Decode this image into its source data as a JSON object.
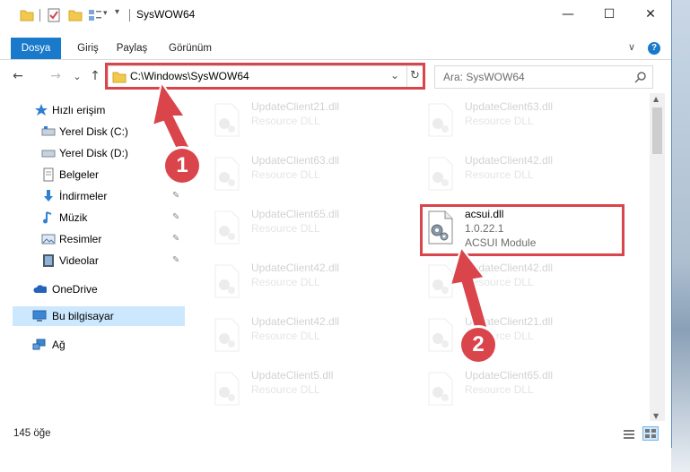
{
  "window": {
    "title": "SysWOW64",
    "minimize_glyph": "—",
    "maximize_glyph": "☐",
    "close_glyph": "✕"
  },
  "ribbon": {
    "tabs": [
      "Dosya",
      "Giriş",
      "Paylaş",
      "Görünüm"
    ],
    "help_glyph": "?",
    "collapse_glyph": "∨"
  },
  "nav": {
    "back_glyph": "←",
    "forward_glyph": "→",
    "recent_glyph": "⌄",
    "up_glyph": "↑",
    "address": "C:\\Windows\\SysWOW64",
    "refresh_glyph": "↻",
    "dropdown_glyph": "⌄",
    "search_placeholder": "Ara: SysWOW64",
    "search_icon": "search-icon"
  },
  "sidebar": {
    "items": [
      {
        "label": "Hızlı erişim",
        "icon": "star-icon"
      },
      {
        "label": "Yerel Disk (C:)",
        "icon": "drive-icon"
      },
      {
        "label": "Yerel Disk (D:)",
        "icon": "drive-icon"
      },
      {
        "label": "Belgeler",
        "icon": "documents-icon"
      },
      {
        "label": "İndirmeler",
        "icon": "download-icon"
      },
      {
        "label": "Müzik",
        "icon": "music-icon"
      },
      {
        "label": "Resimler",
        "icon": "pictures-icon"
      },
      {
        "label": "Videolar",
        "icon": "video-icon"
      },
      {
        "label": "OneDrive",
        "icon": "cloud-icon"
      },
      {
        "label": "Bu bilgisayar",
        "icon": "computer-icon"
      },
      {
        "label": "Ağ",
        "icon": "network-icon"
      }
    ],
    "pin_glyph": "📌"
  },
  "files": [
    {
      "name": "UpdateClient21.dll",
      "sub": "Resource DLL"
    },
    {
      "name": "UpdateClient63.dll",
      "sub": "Resource DLL"
    },
    {
      "name": "UpdateClient63.dll",
      "sub": "Resource DLL"
    },
    {
      "name": "UpdateClient42.dll",
      "sub": "Resource DLL"
    },
    {
      "name": "UpdateClient65.dll",
      "sub": "Resource DLL"
    },
    {
      "name": "acsui.dll",
      "sub": "1.0.22.1",
      "sub2": "ACSUI Module"
    },
    {
      "name": "UpdateClient42.dll",
      "sub": "Resource DLL"
    },
    {
      "name": "UpdateClient42.dll",
      "sub": "Resource DLL"
    },
    {
      "name": "UpdateClient42.dll",
      "sub": "Resource DLL"
    },
    {
      "name": "UpdateClient21.dll",
      "sub": "Resource DLL"
    },
    {
      "name": "UpdateClient5.dll",
      "sub": "Resource DLL"
    },
    {
      "name": "UpdateClient65.dll",
      "sub": "Resource DLL"
    }
  ],
  "status": {
    "count": "145 öğe"
  },
  "callouts": [
    "1",
    "2"
  ],
  "colors": {
    "accent": "#1979ca",
    "highlight": "#d9454b",
    "selected_bg": "#cce8ff"
  }
}
